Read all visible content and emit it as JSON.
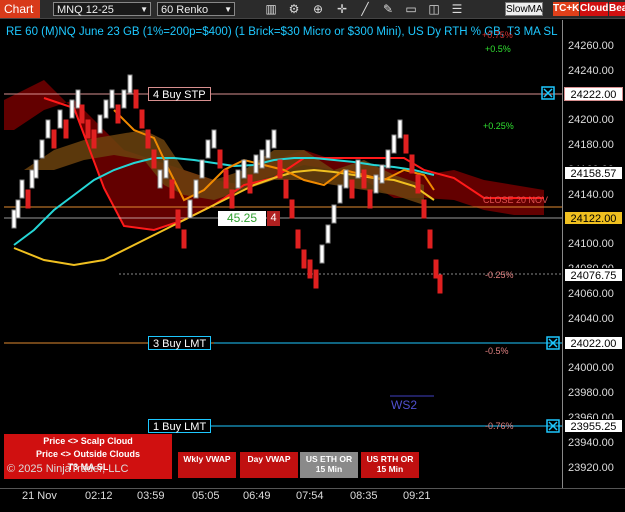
{
  "toolbar": {
    "tab_label": "Chart",
    "instrument": "MNQ 12-25",
    "bar_type": "60 Renko",
    "slow_ma_label": "SlowMA",
    "tc_label": "TC+K",
    "cloud_label": "Cloud",
    "bear_label": "Bear",
    "icons": [
      "bar-chart-icon",
      "gear-icon",
      "zoom-icon",
      "crosshair-icon",
      "draw-line-icon",
      "pencil-icon",
      "horizontal-line-icon",
      "ruler-icon"
    ]
  },
  "header": {
    "title": "RE 60 (M)NQ June 23 GB (1%=200p=$400) (1 Brick=$30 Micro or $300 Mini), US Dy RTH % GB, T3 MA SL"
  },
  "y_axis": {
    "ticks": [
      "24260.00",
      "24240.00",
      "24220.00",
      "24200.00",
      "24180.00",
      "24160.00",
      "24140.00",
      "24120.00",
      "24100.00",
      "24080.00",
      "24060.00",
      "24040.00",
      "24020.00",
      "24000.00",
      "23980.00",
      "23960.00",
      "23940.00",
      "23920.00"
    ],
    "price_boxes": [
      "24222.00",
      "24158.57",
      "24122.00",
      "24076.75",
      "24022.00",
      "23955.25"
    ]
  },
  "x_axis": {
    "ticks": [
      "21 Nov",
      "02:12",
      "03:59",
      "05:05",
      "06:49",
      "07:54",
      "08:35",
      "09:21"
    ]
  },
  "orders": {
    "buy_stp": "4 Buy STP",
    "buy_lmt_3": "3 Buy LMT",
    "buy_lmt_1": "1 Buy LMT"
  },
  "position": {
    "pnl": "45.25",
    "qty": "4"
  },
  "pct_labels": {
    "p050": "+0.5%",
    "p025": "+0.25%",
    "close": "CLOSE 20 NOV",
    "m025": "-0.25%",
    "m050": "-0.5%",
    "m076": "-0.76%",
    "top": "+0.75%"
  },
  "panel": {
    "row1": "Price <> Scalp Cloud",
    "row2": "Price <> Outside Clouds",
    "row3": "T3 MA SL",
    "copyright": "© 2025 NinjaTrader, LLC"
  },
  "buttons": {
    "wkly_vwap": "Wkly VWAP",
    "day_vwap": "Day VWAP",
    "us_eth_or": "US ETH OR 15 Min",
    "us_rth_or": "US RTH OR 15 Min"
  },
  "ws2_label": "WS2",
  "colors": {
    "accent_tab": "#d83a1a",
    "cyan_text": "#1ec8ff",
    "cloud_red": "#8a0000",
    "cloud_brown": "#7a4a12",
    "ma_cyan": "#25d6d6",
    "ma_yellow": "#f0c020",
    "ma_orange": "#f08a00",
    "button_red": "#d01010",
    "button_grey": "#8a8a8a"
  }
}
